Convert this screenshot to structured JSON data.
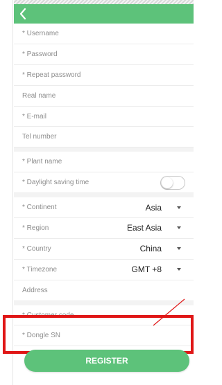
{
  "header": {
    "back_icon": "chevron-left-icon"
  },
  "fields": {
    "username": "* Username",
    "password": "* Password",
    "repeat_password": "* Repeat password",
    "real_name": "Real name",
    "email": "* E-mail",
    "tel_number": "Tel number",
    "plant_name": "* Plant name",
    "daylight_saving": "* Daylight saving time",
    "continent_label": "* Continent",
    "continent_value": "Asia",
    "region_label": "* Region",
    "region_value": "East Asia",
    "country_label": "* Country",
    "country_value": "China",
    "timezone_label": "* Timezone",
    "timezone_value": "GMT +8",
    "address": "Address",
    "customer_code": "* Customer code",
    "dongle_sn": "* Dongle SN"
  },
  "daylight_saving_on": false,
  "register_label": "REGISTER",
  "colors": {
    "accent": "#5dc27a",
    "highlight": "#e01616"
  }
}
